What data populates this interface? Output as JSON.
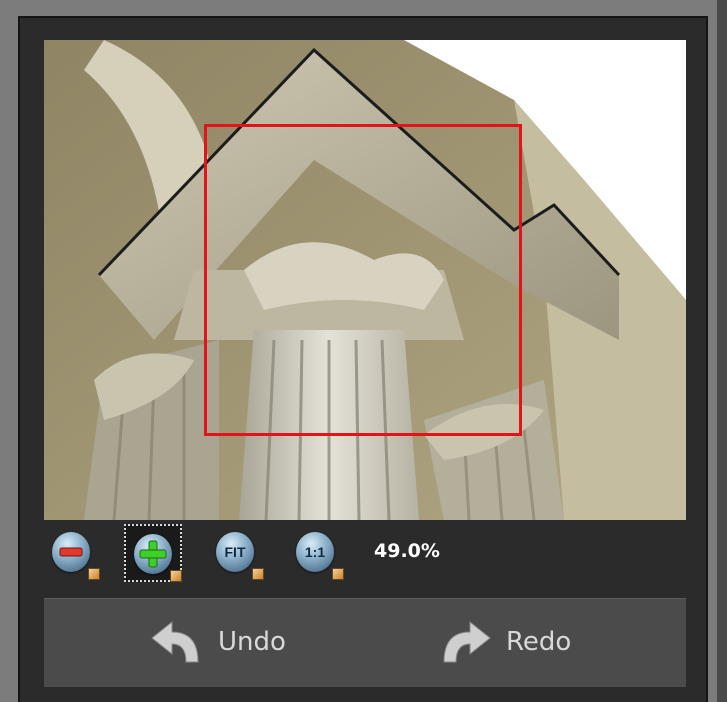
{
  "zoom": {
    "level": "49.0%",
    "buttons": [
      {
        "name": "zoom-out",
        "glyph": ""
      },
      {
        "name": "zoom-in",
        "glyph": ""
      },
      {
        "name": "zoom-fit",
        "glyph": "FIT"
      },
      {
        "name": "zoom-actual",
        "glyph": "1:1"
      }
    ],
    "active": "zoom-in"
  },
  "history": {
    "undo_label": "Undo",
    "redo_label": "Redo"
  },
  "colors": {
    "panel_bg": "#2b2b2b",
    "crop_rect": "#e2141a",
    "button_bar_bg": "#4b4b4b",
    "text_light": "#d9d9d9"
  },
  "icons": {
    "zoom_out": "minus-orb-icon",
    "zoom_in": "plus-orb-icon",
    "fit": "fit-orb-icon",
    "actual": "one-to-one-orb-icon",
    "undo": "undo-arrow-icon",
    "redo": "redo-arrow-icon"
  }
}
